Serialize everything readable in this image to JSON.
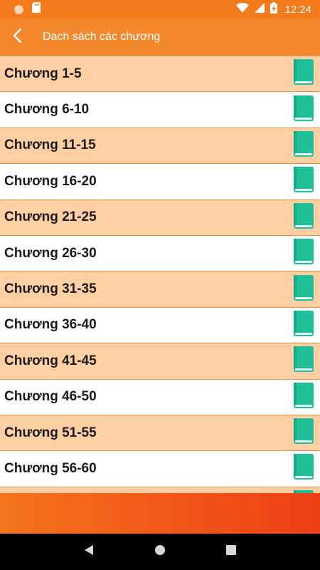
{
  "status_bar": {
    "time": "12:24",
    "icons": [
      "notification-dot-icon",
      "sd-card-icon",
      "wifi-icon",
      "signal-icon",
      "battery-charging-icon"
    ]
  },
  "app_bar": {
    "title": "Dach sách các chương",
    "back_icon": "chevron-left-icon"
  },
  "chapters": [
    {
      "label": "Chương 1-5",
      "icon": "book-icon"
    },
    {
      "label": "Chương 6-10",
      "icon": "book-icon"
    },
    {
      "label": "Chương 11-15",
      "icon": "book-icon"
    },
    {
      "label": "Chương 16-20",
      "icon": "book-icon"
    },
    {
      "label": "Chương 21-25",
      "icon": "book-icon"
    },
    {
      "label": "Chương 26-30",
      "icon": "book-icon"
    },
    {
      "label": "Chương 31-35",
      "icon": "book-icon"
    },
    {
      "label": "Chương 36-40",
      "icon": "book-icon"
    },
    {
      "label": "Chương 41-45",
      "icon": "book-icon"
    },
    {
      "label": "Chương 46-50",
      "icon": "book-icon"
    },
    {
      "label": "Chương 51-55",
      "icon": "book-icon"
    },
    {
      "label": "Chương 56-60",
      "icon": "book-icon"
    },
    {
      "label": "",
      "icon": "book-icon"
    }
  ],
  "colors": {
    "status_bar": "#f27a1a",
    "app_bar": "#f4882c",
    "row_odd": "#fdcfa3",
    "row_even": "#ffffff",
    "book_icon": "#1fbf9a"
  },
  "nav_bar": {
    "icons": [
      "back-triangle-icon",
      "home-circle-icon",
      "recents-square-icon"
    ]
  }
}
